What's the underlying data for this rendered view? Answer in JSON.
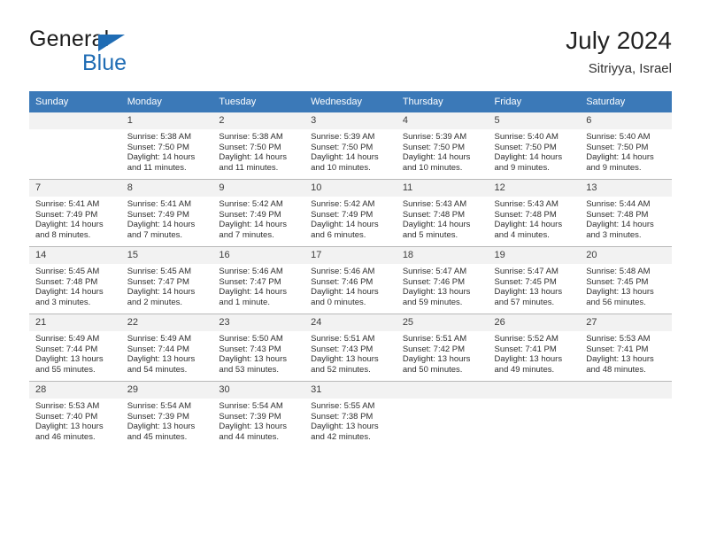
{
  "brand": {
    "name_top": "General",
    "name_bottom": "Blue",
    "accent_color": "#1f6cb4"
  },
  "header": {
    "title": "July 2024",
    "subtitle": "Sitriyya, Israel"
  },
  "colors": {
    "header_row_bg": "#3b79b8",
    "header_row_text": "#ffffff",
    "daynum_bg": "#f2f2f2",
    "grid_line": "#b9b9b9"
  },
  "weekdays": [
    "Sunday",
    "Monday",
    "Tuesday",
    "Wednesday",
    "Thursday",
    "Friday",
    "Saturday"
  ],
  "labels": {
    "sunrise_prefix": "Sunrise:",
    "sunset_prefix": "Sunset:",
    "daylight_prefix": "Daylight:"
  },
  "weeks": [
    [
      {
        "day": "",
        "empty": true
      },
      {
        "day": "1",
        "sunrise": "Sunrise: 5:38 AM",
        "sunset": "Sunset: 7:50 PM",
        "daylight_l1": "Daylight: 14 hours",
        "daylight_l2": "and 11 minutes."
      },
      {
        "day": "2",
        "sunrise": "Sunrise: 5:38 AM",
        "sunset": "Sunset: 7:50 PM",
        "daylight_l1": "Daylight: 14 hours",
        "daylight_l2": "and 11 minutes."
      },
      {
        "day": "3",
        "sunrise": "Sunrise: 5:39 AM",
        "sunset": "Sunset: 7:50 PM",
        "daylight_l1": "Daylight: 14 hours",
        "daylight_l2": "and 10 minutes."
      },
      {
        "day": "4",
        "sunrise": "Sunrise: 5:39 AM",
        "sunset": "Sunset: 7:50 PM",
        "daylight_l1": "Daylight: 14 hours",
        "daylight_l2": "and 10 minutes."
      },
      {
        "day": "5",
        "sunrise": "Sunrise: 5:40 AM",
        "sunset": "Sunset: 7:50 PM",
        "daylight_l1": "Daylight: 14 hours",
        "daylight_l2": "and 9 minutes."
      },
      {
        "day": "6",
        "sunrise": "Sunrise: 5:40 AM",
        "sunset": "Sunset: 7:50 PM",
        "daylight_l1": "Daylight: 14 hours",
        "daylight_l2": "and 9 minutes."
      }
    ],
    [
      {
        "day": "7",
        "sunrise": "Sunrise: 5:41 AM",
        "sunset": "Sunset: 7:49 PM",
        "daylight_l1": "Daylight: 14 hours",
        "daylight_l2": "and 8 minutes."
      },
      {
        "day": "8",
        "sunrise": "Sunrise: 5:41 AM",
        "sunset": "Sunset: 7:49 PM",
        "daylight_l1": "Daylight: 14 hours",
        "daylight_l2": "and 7 minutes."
      },
      {
        "day": "9",
        "sunrise": "Sunrise: 5:42 AM",
        "sunset": "Sunset: 7:49 PM",
        "daylight_l1": "Daylight: 14 hours",
        "daylight_l2": "and 7 minutes."
      },
      {
        "day": "10",
        "sunrise": "Sunrise: 5:42 AM",
        "sunset": "Sunset: 7:49 PM",
        "daylight_l1": "Daylight: 14 hours",
        "daylight_l2": "and 6 minutes."
      },
      {
        "day": "11",
        "sunrise": "Sunrise: 5:43 AM",
        "sunset": "Sunset: 7:48 PM",
        "daylight_l1": "Daylight: 14 hours",
        "daylight_l2": "and 5 minutes."
      },
      {
        "day": "12",
        "sunrise": "Sunrise: 5:43 AM",
        "sunset": "Sunset: 7:48 PM",
        "daylight_l1": "Daylight: 14 hours",
        "daylight_l2": "and 4 minutes."
      },
      {
        "day": "13",
        "sunrise": "Sunrise: 5:44 AM",
        "sunset": "Sunset: 7:48 PM",
        "daylight_l1": "Daylight: 14 hours",
        "daylight_l2": "and 3 minutes."
      }
    ],
    [
      {
        "day": "14",
        "sunrise": "Sunrise: 5:45 AM",
        "sunset": "Sunset: 7:48 PM",
        "daylight_l1": "Daylight: 14 hours",
        "daylight_l2": "and 3 minutes."
      },
      {
        "day": "15",
        "sunrise": "Sunrise: 5:45 AM",
        "sunset": "Sunset: 7:47 PM",
        "daylight_l1": "Daylight: 14 hours",
        "daylight_l2": "and 2 minutes."
      },
      {
        "day": "16",
        "sunrise": "Sunrise: 5:46 AM",
        "sunset": "Sunset: 7:47 PM",
        "daylight_l1": "Daylight: 14 hours",
        "daylight_l2": "and 1 minute."
      },
      {
        "day": "17",
        "sunrise": "Sunrise: 5:46 AM",
        "sunset": "Sunset: 7:46 PM",
        "daylight_l1": "Daylight: 14 hours",
        "daylight_l2": "and 0 minutes."
      },
      {
        "day": "18",
        "sunrise": "Sunrise: 5:47 AM",
        "sunset": "Sunset: 7:46 PM",
        "daylight_l1": "Daylight: 13 hours",
        "daylight_l2": "and 59 minutes."
      },
      {
        "day": "19",
        "sunrise": "Sunrise: 5:47 AM",
        "sunset": "Sunset: 7:45 PM",
        "daylight_l1": "Daylight: 13 hours",
        "daylight_l2": "and 57 minutes."
      },
      {
        "day": "20",
        "sunrise": "Sunrise: 5:48 AM",
        "sunset": "Sunset: 7:45 PM",
        "daylight_l1": "Daylight: 13 hours",
        "daylight_l2": "and 56 minutes."
      }
    ],
    [
      {
        "day": "21",
        "sunrise": "Sunrise: 5:49 AM",
        "sunset": "Sunset: 7:44 PM",
        "daylight_l1": "Daylight: 13 hours",
        "daylight_l2": "and 55 minutes."
      },
      {
        "day": "22",
        "sunrise": "Sunrise: 5:49 AM",
        "sunset": "Sunset: 7:44 PM",
        "daylight_l1": "Daylight: 13 hours",
        "daylight_l2": "and 54 minutes."
      },
      {
        "day": "23",
        "sunrise": "Sunrise: 5:50 AM",
        "sunset": "Sunset: 7:43 PM",
        "daylight_l1": "Daylight: 13 hours",
        "daylight_l2": "and 53 minutes."
      },
      {
        "day": "24",
        "sunrise": "Sunrise: 5:51 AM",
        "sunset": "Sunset: 7:43 PM",
        "daylight_l1": "Daylight: 13 hours",
        "daylight_l2": "and 52 minutes."
      },
      {
        "day": "25",
        "sunrise": "Sunrise: 5:51 AM",
        "sunset": "Sunset: 7:42 PM",
        "daylight_l1": "Daylight: 13 hours",
        "daylight_l2": "and 50 minutes."
      },
      {
        "day": "26",
        "sunrise": "Sunrise: 5:52 AM",
        "sunset": "Sunset: 7:41 PM",
        "daylight_l1": "Daylight: 13 hours",
        "daylight_l2": "and 49 minutes."
      },
      {
        "day": "27",
        "sunrise": "Sunrise: 5:53 AM",
        "sunset": "Sunset: 7:41 PM",
        "daylight_l1": "Daylight: 13 hours",
        "daylight_l2": "and 48 minutes."
      }
    ],
    [
      {
        "day": "28",
        "sunrise": "Sunrise: 5:53 AM",
        "sunset": "Sunset: 7:40 PM",
        "daylight_l1": "Daylight: 13 hours",
        "daylight_l2": "and 46 minutes."
      },
      {
        "day": "29",
        "sunrise": "Sunrise: 5:54 AM",
        "sunset": "Sunset: 7:39 PM",
        "daylight_l1": "Daylight: 13 hours",
        "daylight_l2": "and 45 minutes."
      },
      {
        "day": "30",
        "sunrise": "Sunrise: 5:54 AM",
        "sunset": "Sunset: 7:39 PM",
        "daylight_l1": "Daylight: 13 hours",
        "daylight_l2": "and 44 minutes."
      },
      {
        "day": "31",
        "sunrise": "Sunrise: 5:55 AM",
        "sunset": "Sunset: 7:38 PM",
        "daylight_l1": "Daylight: 13 hours",
        "daylight_l2": "and 42 minutes."
      },
      {
        "day": "",
        "empty": true
      },
      {
        "day": "",
        "empty": true
      },
      {
        "day": "",
        "empty": true
      }
    ]
  ]
}
